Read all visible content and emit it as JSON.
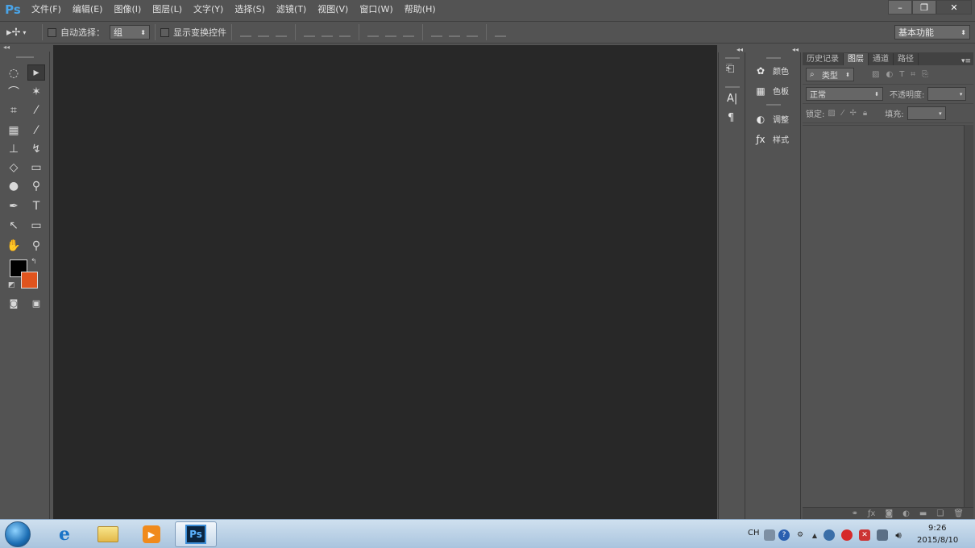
{
  "app": {
    "logo": "Ps"
  },
  "menu": [
    "文件(F)",
    "编辑(E)",
    "图像(I)",
    "图层(L)",
    "文字(Y)",
    "选择(S)",
    "滤镜(T)",
    "视图(V)",
    "窗口(W)",
    "帮助(H)"
  ],
  "window_controls": {
    "minimize": "–",
    "restore": "❐",
    "close": "✕"
  },
  "options_bar": {
    "auto_select_label": "自动选择：",
    "auto_select_value": "组",
    "show_transform_label": "显示变换控件",
    "workspace": "基本功能"
  },
  "side_panels": {
    "color": "颜色",
    "swatches": "色板",
    "adjustments": "调整",
    "styles": "样式"
  },
  "layers_panel": {
    "tabs": [
      "历史记录",
      "图层",
      "通道",
      "路径"
    ],
    "active_tab": 1,
    "filter_kind": "类型",
    "blend_mode": "正常",
    "opacity_label": "不透明度:",
    "lock_label": "锁定:",
    "fill_label": "填充:"
  },
  "colors": {
    "foreground": "#000000",
    "background": "#e0541e",
    "canvas": "#282828",
    "panel": "#535353"
  },
  "taskbar": {
    "ime": "CH",
    "time": "9:26",
    "date": "2015/8/10",
    "ps_label": "Ps"
  }
}
